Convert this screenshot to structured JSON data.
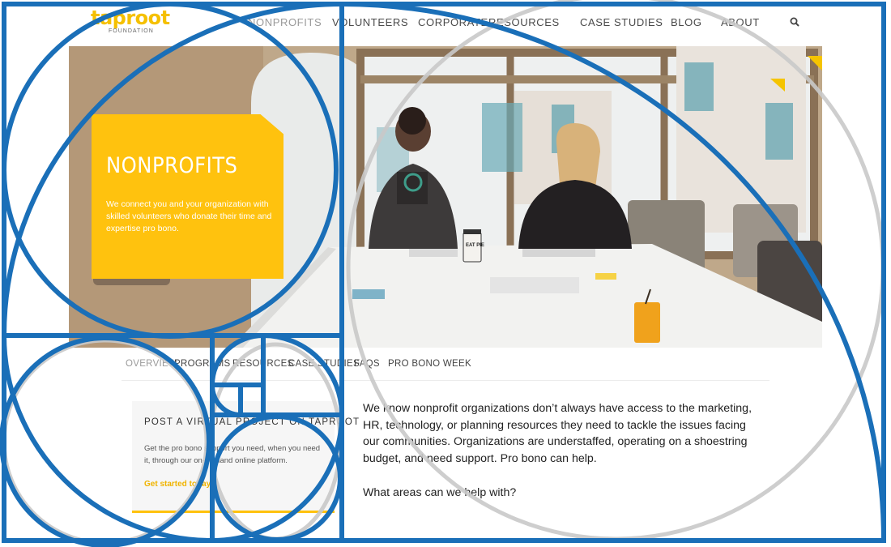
{
  "logo": {
    "wordmark": "taproot",
    "sub": "FOUNDATION"
  },
  "nav": {
    "items": [
      "NONPROFITS",
      "VOLUNTEERS",
      "CORPORATE",
      "RESOURCES",
      "CASE STUDIES",
      "BLOG",
      "ABOUT"
    ],
    "active": "NONPROFITS",
    "search_icon": "search-icon"
  },
  "hero": {
    "title": "NONPROFITS",
    "text": "We connect you and your organization with skilled volunteers who donate their time and expertise pro bono.",
    "photo_caption_cup": "EAT PIE"
  },
  "tabs": {
    "items": [
      "OVERVIEW",
      "PROGRAMS",
      "RESOURCES",
      "CASE STUDIES",
      "FAQS",
      "PRO BONO WEEK"
    ],
    "active": "OVERVIEW"
  },
  "side_card": {
    "heading": "POST A VIRTUAL PROJECT ON TAPROOT",
    "text": "Get the pro bono support you need, when you need it, through our on-demand online platform.",
    "link": "Get started today"
  },
  "body": {
    "paragraph": "We know nonprofit organizations don’t always have access to the marketing, HR, technology, or planning resources they need to tackle the issues facing our communities. Organizations are understaffed, operating on a shoestring budget, and need support. Pro bono can help.",
    "question": "What areas can we help with?"
  },
  "colors": {
    "brand_yellow": "#ffc20e",
    "overlay_blue": "#1a6fb8",
    "overlay_gray": "#c9c9c9"
  }
}
